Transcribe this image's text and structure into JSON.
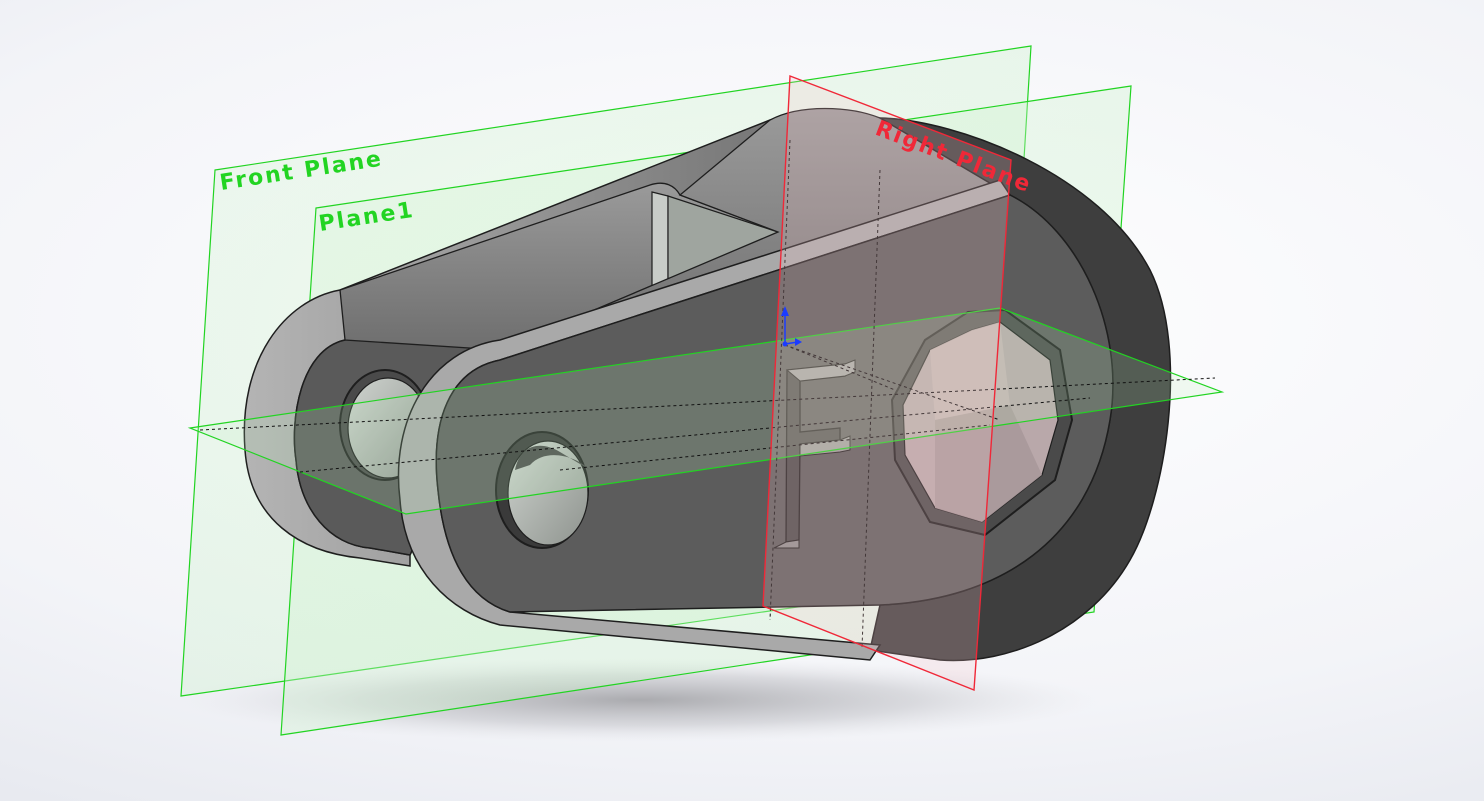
{
  "viewport": {
    "background": "#f4f5f8",
    "part_color": "#5c5c5c",
    "part_edge_color": "#1e1e1e"
  },
  "planes": {
    "front_plane": {
      "label": "Front Plane",
      "color": "#22d422",
      "selected": false
    },
    "plane1": {
      "label": "Plane1",
      "color": "#22d422",
      "selected": false
    },
    "right_plane": {
      "label": "Right Plane",
      "color": "#f02838",
      "selected": true
    },
    "top_plane": {
      "color": "#22d422",
      "selected": false
    }
  },
  "features": {
    "engraved_letter": "F"
  },
  "icons": {
    "origin": "origin-triad-icon"
  }
}
